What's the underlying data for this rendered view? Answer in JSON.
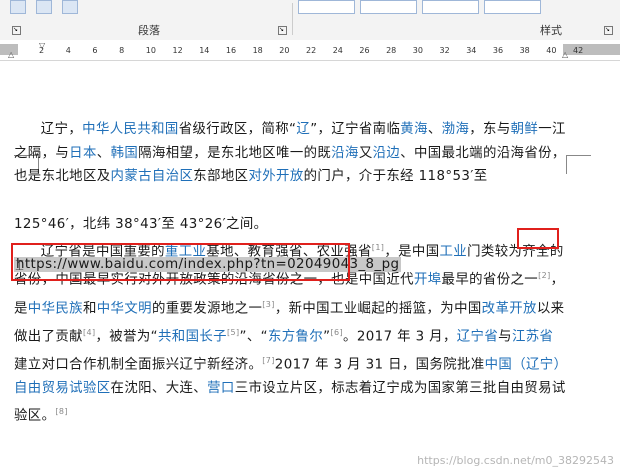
{
  "ribbon": {
    "group_paragraph": "段落",
    "group_styles": "样式"
  },
  "ruler": {
    "ticks": [
      "2",
      "4",
      "6",
      "8",
      "10",
      "12",
      "14",
      "16",
      "18",
      "20",
      "22",
      "24",
      "26",
      "28",
      "30",
      "32",
      "34",
      "36",
      "38",
      "40",
      "42"
    ]
  },
  "document": {
    "p1_runs": [
      {
        "t": "辽宁，",
        "c": "n"
      },
      {
        "t": "中华人民共和国",
        "c": "l"
      },
      {
        "t": "省级行政区，简称“",
        "c": "n"
      },
      {
        "t": "辽",
        "c": "l"
      },
      {
        "t": "”，辽宁省南临",
        "c": "n"
      },
      {
        "t": "黄海",
        "c": "l"
      },
      {
        "t": "、",
        "c": "n"
      },
      {
        "t": "渤海",
        "c": "l"
      },
      {
        "t": "，东与",
        "c": "n"
      },
      {
        "t": "朝鲜",
        "c": "l"
      },
      {
        "t": "一江之隔，与",
        "c": "n"
      },
      {
        "t": "日本",
        "c": "l"
      },
      {
        "t": "、",
        "c": "n"
      },
      {
        "t": "韩国",
        "c": "l"
      },
      {
        "t": "隔海相望，是东北地区唯一的既",
        "c": "n"
      },
      {
        "t": "沿海",
        "c": "l"
      },
      {
        "t": "又",
        "c": "n"
      },
      {
        "t": "沿边",
        "c": "l"
      },
      {
        "t": "、中国最北端的沿海省份，也是东北地区及",
        "c": "n"
      },
      {
        "t": "内蒙古自治区",
        "c": "l"
      },
      {
        "t": "东部地区",
        "c": "n"
      },
      {
        "t": "对外开放",
        "c": "l"
      },
      {
        "t": "的门户，介于东经 118°53′至",
        "c": "n"
      }
    ],
    "url_text": "https://www.baidu.com/index.php?tn=02049043_8_pg",
    "p1_tail": "125°46′，北纬 38°43′至 43°26′之间。",
    "p2_runs": [
      {
        "t": "辽宁省是中国重要的",
        "c": "n"
      },
      {
        "t": "重工业",
        "c": "l"
      },
      {
        "t": "基地、教育强省、农业强省",
        "c": "n"
      },
      {
        "t": "[1]",
        "c": "m"
      },
      {
        "t": "，是中国",
        "c": "n"
      },
      {
        "t": "工业",
        "c": "l"
      },
      {
        "t": "门类较为齐全的省份，中国最早实行对外开放政策的沿海省份之一，也是中国近代",
        "c": "n"
      },
      {
        "t": "开埠",
        "c": "l"
      },
      {
        "t": "最早的省份之一",
        "c": "n"
      },
      {
        "t": "[2]",
        "c": "m"
      },
      {
        "t": "，是",
        "c": "n"
      },
      {
        "t": "中华民族",
        "c": "l"
      },
      {
        "t": "和",
        "c": "n"
      },
      {
        "t": "中华文明",
        "c": "l"
      },
      {
        "t": "的重要发源地之一",
        "c": "n"
      },
      {
        "t": "[3]",
        "c": "m"
      },
      {
        "t": "，新中国工业崛起的摇篮，为中国",
        "c": "n"
      },
      {
        "t": "改革开放",
        "c": "l"
      },
      {
        "t": "以来做出了贡献",
        "c": "n"
      },
      {
        "t": "[4]",
        "c": "m"
      },
      {
        "t": "，被誉为“",
        "c": "n"
      },
      {
        "t": "共和国长子",
        "c": "l"
      },
      {
        "t": "[5]",
        "c": "m"
      },
      {
        "t": "”、“",
        "c": "n"
      },
      {
        "t": "东方鲁尔",
        "c": "l"
      },
      {
        "t": "”",
        "c": "n"
      },
      {
        "t": "[6]",
        "c": "m"
      },
      {
        "t": "。2017 年 3 月，",
        "c": "n"
      },
      {
        "t": "辽宁省",
        "c": "l"
      },
      {
        "t": "与",
        "c": "n"
      },
      {
        "t": "江苏省",
        "c": "l"
      },
      {
        "t": "建立对口合作机制全面振兴辽宁新经济。",
        "c": "n"
      },
      {
        "t": "[7]",
        "c": "m"
      },
      {
        "t": "2017 年 3 月 31 日，国务院批准",
        "c": "n"
      },
      {
        "t": "中国（辽宁）自由贸易试验区",
        "c": "l"
      },
      {
        "t": "在沈阳、大连、",
        "c": "n"
      },
      {
        "t": "营口",
        "c": "l"
      },
      {
        "t": "三市设立片区，标志着辽宁成为国家第三批自由贸易试验区。",
        "c": "n"
      },
      {
        "t": "[8]",
        "c": "m"
      }
    ]
  },
  "watermark": "https://blog.csdn.net/m0_38292543"
}
